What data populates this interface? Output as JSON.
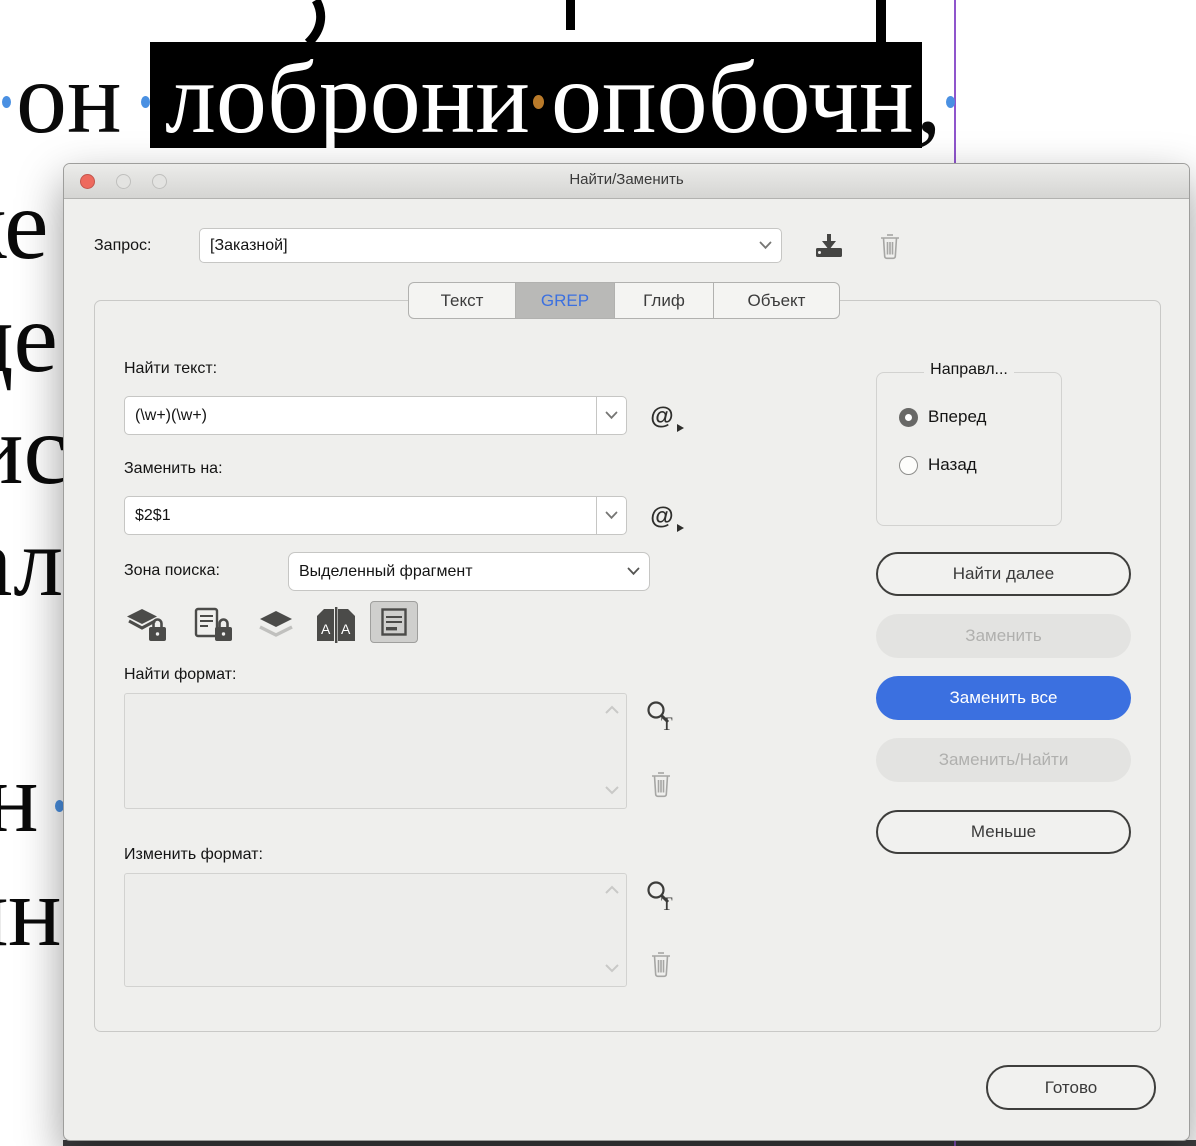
{
  "background": {
    "selected_line": {
      "prefix_word": "он",
      "word1": "лоброни",
      "word2": "опобочн",
      "suffix": ","
    },
    "edge_fragments": [
      "ке",
      "це",
      "ис",
      "ал",
      "н",
      "ян"
    ]
  },
  "window": {
    "title": "Найти/Заменить"
  },
  "query": {
    "label": "Запрос:",
    "value": "[Заказной]"
  },
  "tabs": [
    {
      "label": "Текст"
    },
    {
      "label": "GREP"
    },
    {
      "label": "Глиф"
    },
    {
      "label": "Объект"
    }
  ],
  "fields": {
    "find_label": "Найти текст:",
    "find_value": "(\\w+)(\\w+)",
    "replace_label": "Заменить на:",
    "replace_value": "$2$1",
    "scope_label": "Зона поиска:",
    "scope_value": "Выделенный фрагмент",
    "find_format_label": "Найти формат:",
    "change_format_label": "Изменить формат:"
  },
  "direction": {
    "legend": "Направл...",
    "forward": "Вперед",
    "backward": "Назад"
  },
  "buttons": {
    "find_next": "Найти далее",
    "change": "Заменить",
    "change_all": "Заменить все",
    "change_find": "Заменить/Найти",
    "fewer": "Меньше",
    "done": "Готово"
  },
  "colors": {
    "accent": "#3b70e0",
    "selection-bg": "#000000",
    "dot-blue": "#4a90e2",
    "dot-orange": "#b97a2a",
    "guide-purple": "#8f55cc",
    "traffic-red": "#ee6a5e"
  }
}
